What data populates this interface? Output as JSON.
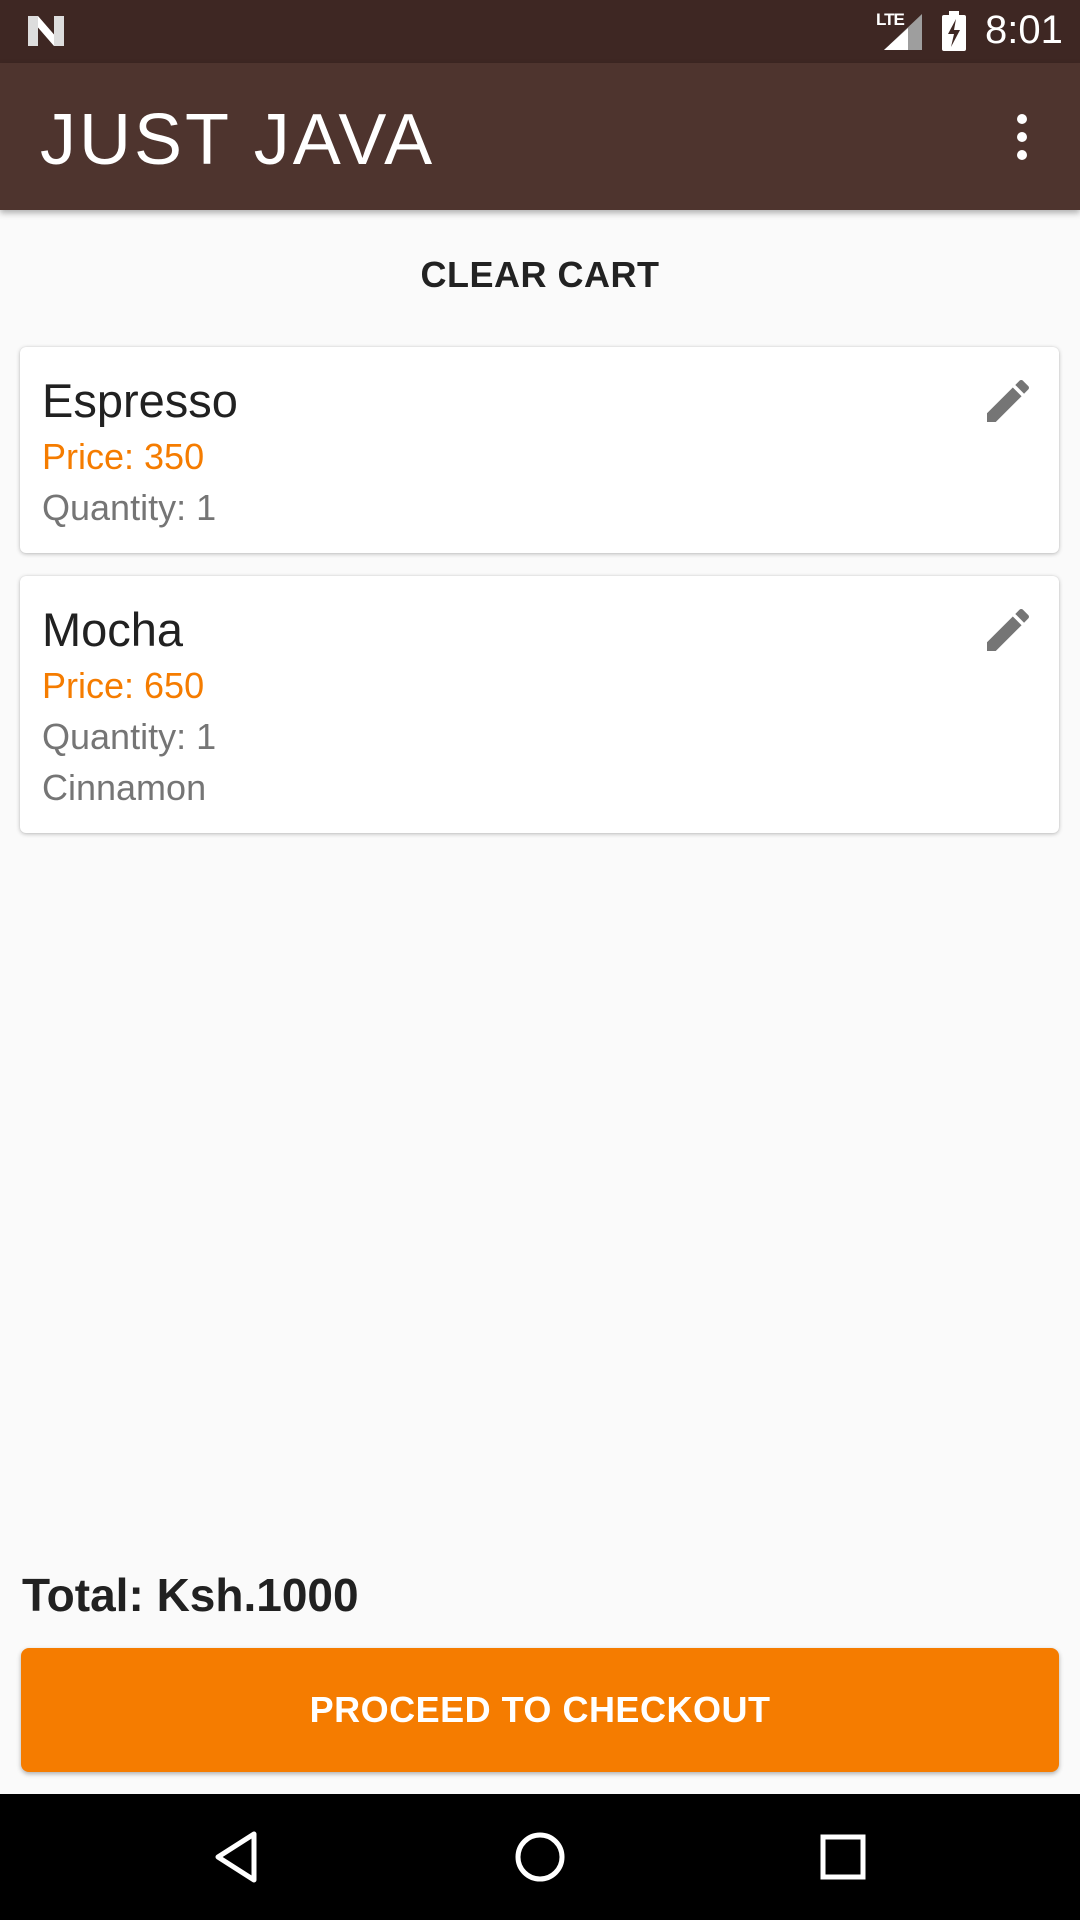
{
  "status_bar": {
    "network": "LTE",
    "time": "8:01",
    "icons": [
      "n-logo-icon",
      "signal-icon",
      "battery-charging-icon"
    ]
  },
  "app_bar": {
    "title": "JUST JAVA",
    "menu_icon": "more-vert-icon"
  },
  "actions": {
    "clear_cart": "CLEAR CART"
  },
  "cart": {
    "items": [
      {
        "name": "Espresso",
        "price": "Price: 350",
        "quantity": "Quantity: 1",
        "extra": "",
        "edit_icon": "pencil-icon"
      },
      {
        "name": "Mocha",
        "price": "Price: 650",
        "quantity": "Quantity: 1",
        "extra": "Cinnamon",
        "edit_icon": "pencil-icon"
      }
    ],
    "total": "Total: Ksh.1000",
    "checkout_label": "PROCEED TO CHECKOUT"
  },
  "nav_bar": {
    "icons": [
      "back-icon",
      "home-icon",
      "recents-icon"
    ]
  },
  "colors": {
    "status_bar": "#3e2723",
    "app_bar": "#4e342e",
    "accent": "#f57c00",
    "background": "#fafafa"
  }
}
